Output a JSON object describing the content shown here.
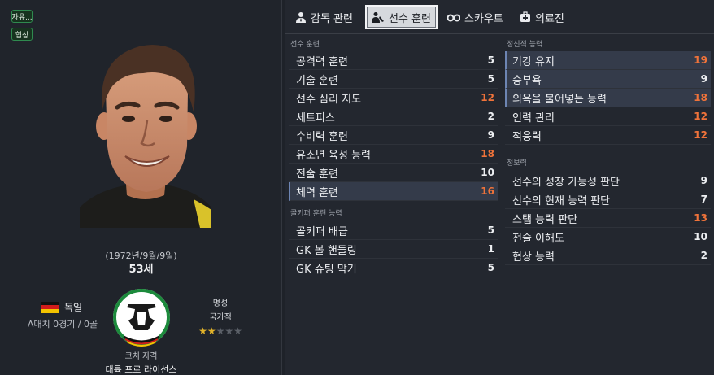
{
  "left_panel": {
    "badges": [
      "자유...",
      "협상"
    ],
    "dob": "(1972년/9월/9일)",
    "age": "53세",
    "nationality": "독일",
    "caps": "A매치 0경기 / 0골",
    "reputation_label": "명성",
    "reputation_value": "국가적",
    "reputation_stars": 2,
    "license_label": "코치 자격",
    "license_value": "대륙 프로 라이선스"
  },
  "tabs": [
    {
      "label": "감독 관련",
      "icon": "person-tie-icon"
    },
    {
      "label": "선수 훈련",
      "icon": "coach-icon"
    },
    {
      "label": "스카우트",
      "icon": "binoculars-icon"
    },
    {
      "label": "의료진",
      "icon": "medkit-icon"
    }
  ],
  "sections": {
    "training_title": "선수 훈련",
    "training": [
      {
        "label": "공격력 훈련",
        "value": "5"
      },
      {
        "label": "기술 훈련",
        "value": "5"
      },
      {
        "label": "선수 심리 지도",
        "value": "12"
      },
      {
        "label": "세트피스",
        "value": "2"
      },
      {
        "label": "수비력 훈련",
        "value": "9"
      },
      {
        "label": "유소년 육성 능력",
        "value": "18"
      },
      {
        "label": "전술 훈련",
        "value": "10"
      },
      {
        "label": "체력 훈련",
        "value": "16"
      }
    ],
    "gk_title": "골키퍼 훈련 능력",
    "gk": [
      {
        "label": "골키퍼 배급",
        "value": "5"
      },
      {
        "label": "GK 볼 핸들링",
        "value": "1"
      },
      {
        "label": "GK 슈팅 막기",
        "value": "5"
      }
    ],
    "mental_title": "정신적 능력",
    "mental": [
      {
        "label": "기강 유지",
        "value": "19"
      },
      {
        "label": "승부욕",
        "value": "9"
      },
      {
        "label": "의욕을 불어넣는 능력",
        "value": "18"
      },
      {
        "label": "인력 관리",
        "value": "12"
      },
      {
        "label": "적응력",
        "value": "12"
      }
    ],
    "knowledge_title": "정보력",
    "knowledge": [
      {
        "label": "선수의 성장 가능성 판단",
        "value": "9"
      },
      {
        "label": "선수의 현재 능력 판단",
        "value": "7"
      },
      {
        "label": "스탭 능력 판단",
        "value": "13"
      },
      {
        "label": "전술 이해도",
        "value": "10"
      },
      {
        "label": "협상 능력",
        "value": "2"
      }
    ]
  },
  "colors": {
    "accent_orange": "#f0733a",
    "highlight_row": "#343b4a",
    "badge_green": "#2f8a4f"
  }
}
